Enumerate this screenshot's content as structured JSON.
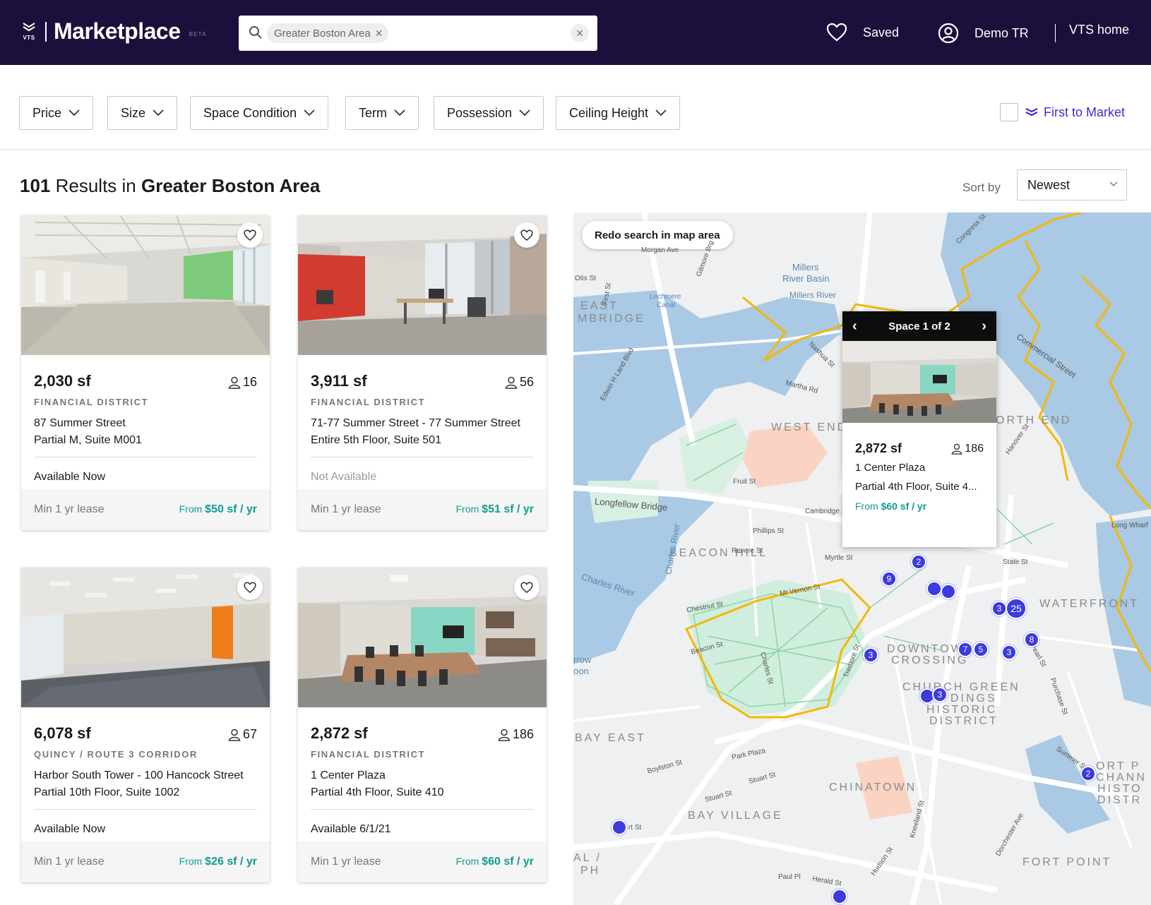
{
  "header": {
    "brand": "Marketplace",
    "beta": "BETA",
    "logo_text": "VTS",
    "search_chip": "Greater Boston Area",
    "saved_label": "Saved",
    "user_label": "Demo TR",
    "home_label": "VTS home"
  },
  "filters": {
    "items": [
      "Price",
      "Size",
      "Space Condition",
      "Term",
      "Possession",
      "Ceiling Height"
    ],
    "first_to_market": "First to Market"
  },
  "results": {
    "count": "101",
    "middle": " Results in ",
    "area": "Greater Boston Area",
    "sort_label": "Sort by",
    "sort_value": "Newest"
  },
  "listings": [
    {
      "size": "2,030 sf",
      "occupancy": "16",
      "district": "FINANCIAL DISTRICT",
      "address": "87 Summer Street",
      "suite": "Partial M, Suite M001",
      "availability": "Available Now",
      "term": "Min 1 yr lease",
      "price_prefix": "From ",
      "price": "$50 sf / yr"
    },
    {
      "size": "3,911 sf",
      "occupancy": "56",
      "district": "FINANCIAL DISTRICT",
      "address": "71-77 Summer Street - 77 Summer Street",
      "suite": "Entire 5th Floor, Suite 501",
      "availability": "Not Available",
      "term": "Min 1 yr lease",
      "price_prefix": "From ",
      "price": "$51 sf / yr"
    },
    {
      "size": "6,078 sf",
      "occupancy": "67",
      "district": "QUINCY / ROUTE 3 CORRIDOR",
      "address": "Harbor South Tower - 100 Hancock Street",
      "suite": "Partial 10th Floor, Suite 1002",
      "availability": "Available Now",
      "term": "Min 1 yr lease",
      "price_prefix": "From ",
      "price": "$26 sf / yr"
    },
    {
      "size": "2,872 sf",
      "occupancy": "186",
      "district": "FINANCIAL DISTRICT",
      "address": "1 Center Plaza",
      "suite": "Partial 4th Floor, Suite 410",
      "availability": "Available 6/1/21",
      "term": "Min 1 yr lease",
      "price_prefix": "From ",
      "price": "$60 sf / yr"
    }
  ],
  "map": {
    "redo_label": "Redo search in map area",
    "popup": {
      "title": "Space 1 of 2",
      "size": "2,872 sf",
      "occupancy": "186",
      "address": "1 Center Plaza",
      "suite": "Partial 4th Floor, Suite 4...",
      "price_prefix": "From ",
      "price": "$60 sf / yr"
    },
    "neighborhoods": [
      "EAST",
      "MBRIDGE",
      "WEST END",
      "BEACON HILL",
      "ORTH END",
      "WATERFRONT",
      "DOWNTOWN",
      "CROSSING",
      "CHURCH GREEN",
      "DINGS",
      "HISTORIC",
      "DISTRICT",
      "BAY EAST",
      "CHINATOWN",
      "BAY VILLAGE",
      "FORT POINT",
      "ORT P",
      "CHANN",
      "HISTO",
      "DISTR",
      "AL /",
      "PH"
    ],
    "labels": [
      "Millers",
      "River Basin",
      "Millers River",
      "Lechmere",
      "Canal",
      "Longfellow Bridge",
      "Charles River",
      "Charles River",
      "Commercial Street",
      "Cambridge St",
      "Boylston St",
      "Park Plaza",
      "Stuart St",
      "Stuart St",
      "Summer St",
      "State St",
      "Martha Rd",
      "Nashua St",
      "Edwin H Land Blvd",
      "Beacon St",
      "Charles St",
      "Fruit St",
      "Revere St",
      "Myrtle St",
      "Mt Vernon St",
      "Chestnut St",
      "Hanover St",
      "Tremont St",
      "Herald St",
      "Hudson St",
      "Kneeland St",
      "Otis St",
      "First St",
      "Morgan Ave",
      "Gilmore Brg",
      "Congress St",
      "Phillips St",
      "Pearl St",
      "Dorchester Ave",
      "Long Wharf",
      "rrow",
      "oon",
      "rt St",
      "Paul Pl",
      "Purchase St"
    ],
    "pins": [
      "2",
      "9",
      "3",
      "25",
      "8",
      "7",
      "5",
      "3",
      "3",
      "3",
      "2",
      "3"
    ]
  },
  "colors": {
    "header_bg": "#1b0f3b",
    "accent": "#3f2fd1",
    "price": "#0f9d8f",
    "pin": "#3c3bde",
    "boundary": "#f5b700"
  }
}
